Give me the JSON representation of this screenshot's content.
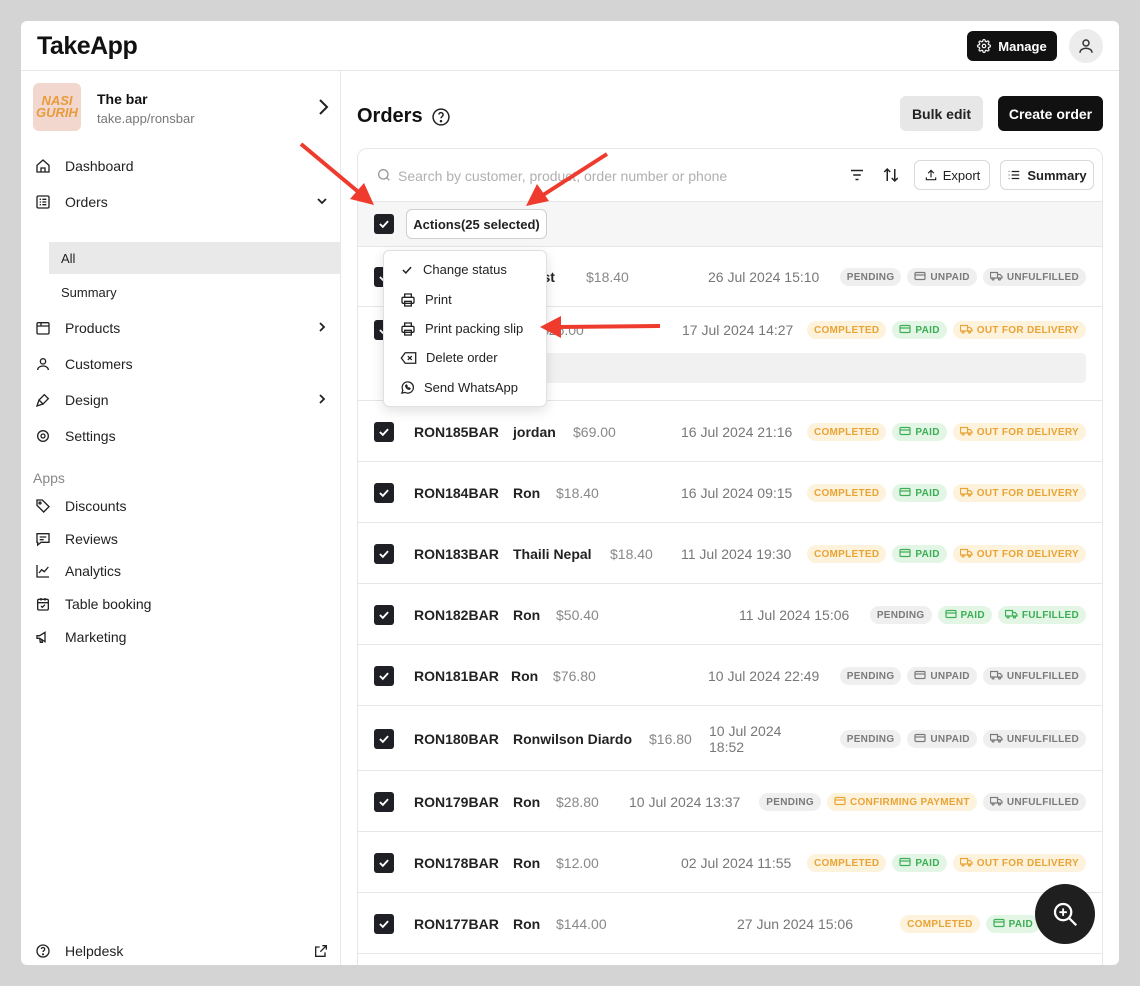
{
  "header": {
    "app_name": "TakeApp",
    "manage_label": "Manage"
  },
  "store": {
    "logo_text": "nasi gurih",
    "name": "The bar",
    "url": "take.app/ronsbar"
  },
  "sidebar": {
    "nav": [
      {
        "label": "Dashboard",
        "icon": "home-icon"
      },
      {
        "label": "Orders",
        "icon": "orders-icon"
      },
      {
        "label": "Products",
        "icon": "box-icon"
      },
      {
        "label": "Customers",
        "icon": "user-icon"
      },
      {
        "label": "Design",
        "icon": "brush-icon"
      },
      {
        "label": "Settings",
        "icon": "gear-icon"
      }
    ],
    "orders_sub": [
      "All",
      "Summary"
    ],
    "apps_label": "Apps",
    "apps": [
      {
        "label": "Discounts",
        "icon": "tag-icon"
      },
      {
        "label": "Reviews",
        "icon": "chat-icon"
      },
      {
        "label": "Analytics",
        "icon": "chart-icon"
      },
      {
        "label": "Table booking",
        "icon": "calendar-icon"
      },
      {
        "label": "Marketing",
        "icon": "megaphone-icon"
      }
    ],
    "helpdesk_label": "Helpdesk"
  },
  "main": {
    "title": "Orders",
    "bulk_edit_label": "Bulk edit",
    "create_order_label": "Create order",
    "search_placeholder": "Search by customer, product, order number or phone",
    "export_label": "Export",
    "summary_label": "Summary",
    "actions_label": "Actions(25 selected)"
  },
  "action_menu": [
    {
      "label": "Change status",
      "icon": "check-icon"
    },
    {
      "label": "Print",
      "icon": "printer-icon"
    },
    {
      "label": "Print packing slip",
      "icon": "printer-icon"
    },
    {
      "label": "Delete order",
      "icon": "delete-icon"
    },
    {
      "label": "Send WhatsApp",
      "icon": "whatsapp-icon"
    }
  ],
  "orders": [
    {
      "id": "",
      "customer": "test",
      "amount": "$18.40",
      "date": "26 Jul 2024 15:10",
      "status": "PENDING",
      "payment": "UNPAID",
      "fulfillment": "UNFULFILLED"
    },
    {
      "id": "",
      "customer": "",
      "amount": "$25.00",
      "date": "17 Jul 2024 14:27",
      "status": "COMPLETED",
      "payment": "PAID",
      "fulfillment": "OUT FOR DELIVERY"
    },
    {
      "id": "RON185BAR",
      "customer": "jordan",
      "amount": "$69.00",
      "date": "16 Jul 2024 21:16",
      "status": "COMPLETED",
      "payment": "PAID",
      "fulfillment": "OUT FOR DELIVERY"
    },
    {
      "id": "RON184BAR",
      "customer": "Ron",
      "amount": "$18.40",
      "date": "16 Jul 2024 09:15",
      "status": "COMPLETED",
      "payment": "PAID",
      "fulfillment": "OUT FOR DELIVERY"
    },
    {
      "id": "RON183BAR",
      "customer": "Thaili Nepal",
      "amount": "$18.40",
      "date": "11 Jul 2024 19:30",
      "status": "COMPLETED",
      "payment": "PAID",
      "fulfillment": "OUT FOR DELIVERY"
    },
    {
      "id": "RON182BAR",
      "customer": "Ron",
      "amount": "$50.40",
      "date": "11 Jul 2024 15:06",
      "status": "PENDING",
      "payment": "PAID",
      "fulfillment": "FULFILLED"
    },
    {
      "id": "RON181BAR",
      "customer": "Ron",
      "amount": "$76.80",
      "date": "10 Jul 2024 22:49",
      "status": "PENDING",
      "payment": "UNPAID",
      "fulfillment": "UNFULFILLED"
    },
    {
      "id": "RON180BAR",
      "customer": "Ronwilson Diardo",
      "amount": "$16.80",
      "date": "10 Jul 2024 18:52",
      "status": "PENDING",
      "payment": "UNPAID",
      "fulfillment": "UNFULFILLED"
    },
    {
      "id": "RON179BAR",
      "customer": "Ron",
      "amount": "$28.80",
      "date": "10 Jul 2024 13:37",
      "status": "PENDING",
      "payment": "CONFIRMING PAYMENT",
      "fulfillment": "UNFULFILLED"
    },
    {
      "id": "RON178BAR",
      "customer": "Ron",
      "amount": "$12.00",
      "date": "02 Jul 2024 11:55",
      "status": "COMPLETED",
      "payment": "PAID",
      "fulfillment": "OUT FOR DELIVERY"
    },
    {
      "id": "RON177BAR",
      "customer": "Ron",
      "amount": "$144.00",
      "date": "27 Jun 2024 15:06",
      "status": "COMPLETED",
      "payment": "PAID",
      "fulfillment": ""
    }
  ],
  "colors": {
    "accent_dark": "#1f1f26",
    "amber": "#e9a437",
    "green": "#3cae54",
    "annotation_red": "#ef3b2d"
  }
}
